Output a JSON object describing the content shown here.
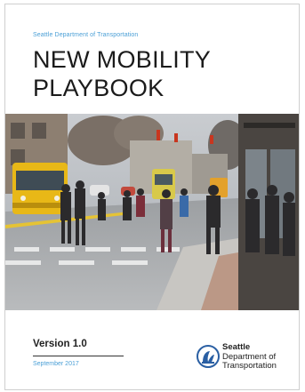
{
  "cover": {
    "department": "Seattle Department of Transportation",
    "title_line1": "NEW MOBILITY",
    "title_line2": "PLAYBOOK",
    "version": "Version 1.0",
    "date": "September 2017"
  },
  "logo": {
    "icon": "seattle-logo-icon",
    "line1": "Seattle",
    "line2": "Department of",
    "line3": "Transportation"
  },
  "colors": {
    "accent_blue": "#4a9fd6",
    "streetcar_yellow": "#e8b817",
    "text_dark": "#1b1b1b"
  }
}
